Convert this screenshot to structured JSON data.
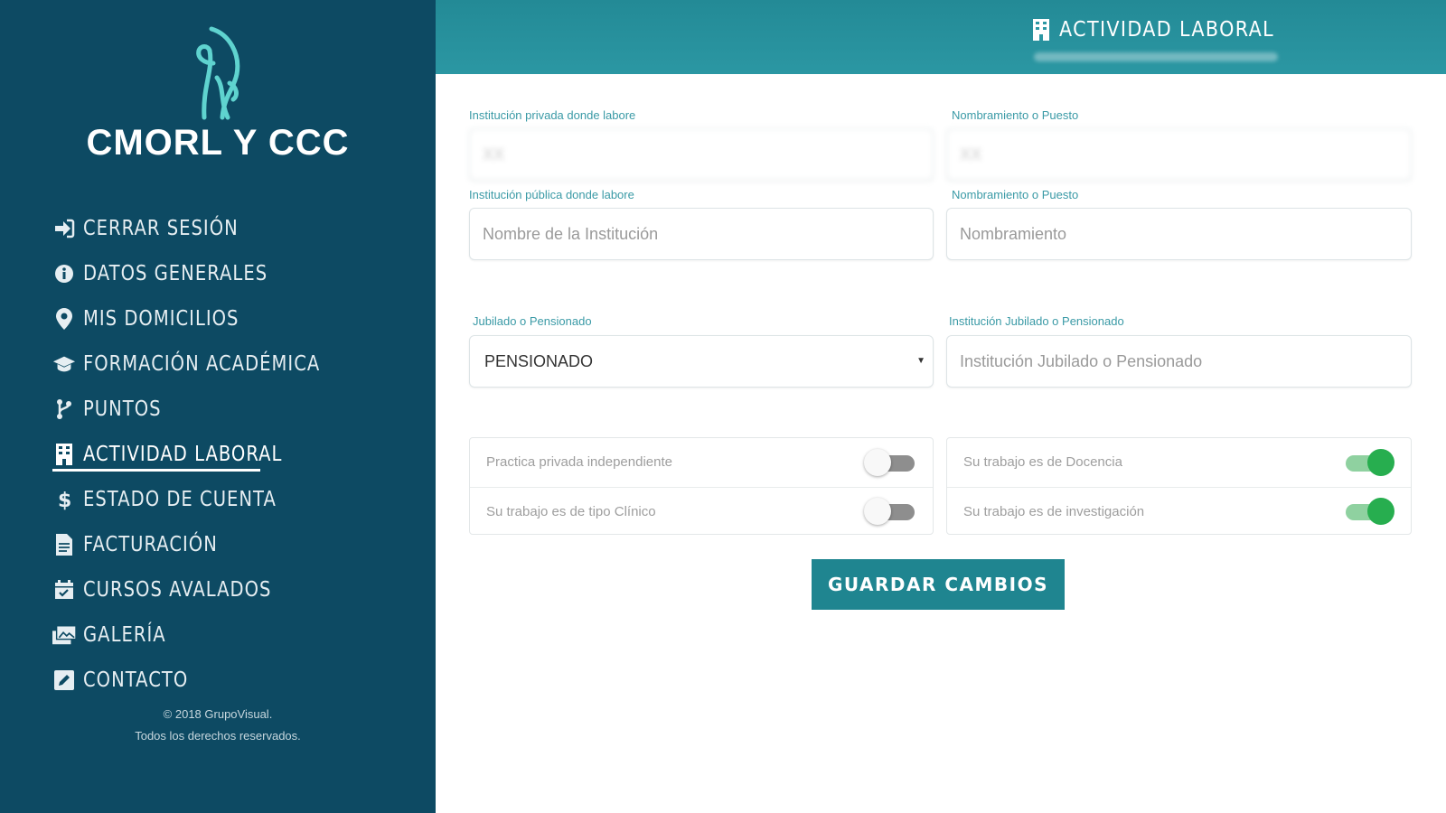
{
  "brand": {
    "name": "CMORL Y CCC"
  },
  "nav": {
    "items": [
      {
        "label": "CERRAR SESIÓN",
        "icon": "sign-in-icon"
      },
      {
        "label": "DATOS GENERALES",
        "icon": "info-circle-icon"
      },
      {
        "label": "MIS DOMICILIOS",
        "icon": "map-marker-icon"
      },
      {
        "label": "FORMACIÓN ACADÉMICA",
        "icon": "graduation-cap-icon"
      },
      {
        "label": "PUNTOS",
        "icon": "branch-icon"
      },
      {
        "label": "ACTIVIDAD LABORAL",
        "icon": "building-icon",
        "active": true
      },
      {
        "label": "ESTADO DE CUENTA",
        "icon": "dollar-icon"
      },
      {
        "label": "FACTURACIÓN",
        "icon": "file-icon"
      },
      {
        "label": "CURSOS AVALADOS",
        "icon": "calendar-check-icon"
      },
      {
        "label": "GALERÍA",
        "icon": "images-icon"
      },
      {
        "label": "CONTACTO",
        "icon": "pencil-square-icon"
      }
    ]
  },
  "footer": {
    "line1": "© 2018 GrupoVisual.",
    "line2": "Todos los derechos reservados."
  },
  "header": {
    "title": "ACTIVIDAD LABORAL"
  },
  "form": {
    "private_institution": {
      "label": "Institución privada donde labore",
      "value": "XX"
    },
    "private_position": {
      "label": "Nombramiento o Puesto",
      "value": "XX"
    },
    "public_institution": {
      "label": "Institución pública donde labore",
      "placeholder": "Nombre de la Institución"
    },
    "public_position": {
      "label": "Nombramiento o Puesto",
      "placeholder": "Nombramiento"
    },
    "retired": {
      "label": "Jubilado o Pensionado",
      "value": "PENSIONADO"
    },
    "retired_institution": {
      "label": "Institución Jubilado o Pensionado",
      "placeholder": "Institución Jubilado o Pensionado"
    }
  },
  "toggles": {
    "private_practice": {
      "label": "Practica privada independiente",
      "on": false
    },
    "clinical": {
      "label": "Su trabajo es de tipo Clínico",
      "on": false
    },
    "teaching": {
      "label": "Su trabajo es de Docencia",
      "on": true
    },
    "research": {
      "label": "Su trabajo es de investigación",
      "on": true
    }
  },
  "actions": {
    "save_label": "GUARDAR CAMBIOS"
  },
  "colors": {
    "sidebar": "#0d4a63",
    "header": "#2b97a3",
    "accent": "#1f8590",
    "toggle_on": "#27ae4f",
    "logo": "#5fd3cf"
  }
}
